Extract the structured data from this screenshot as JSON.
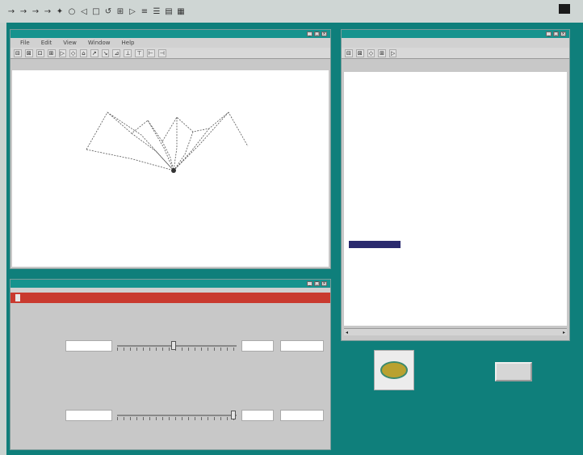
{
  "top_toolbar": {
    "icons": [
      "arrow-icon",
      "arrow-icon",
      "arrow-icon",
      "arrow-icon",
      "cursor-icon",
      "circle-icon",
      "pointer-icon",
      "square-icon",
      "undo-icon",
      "grid-icon",
      "shape-icon",
      "slider-icon",
      "list-icon",
      "save-icon",
      "print-icon"
    ],
    "glyphs": [
      "→",
      "→",
      "→",
      "→",
      "✦",
      "○",
      "◁",
      "□",
      "↺",
      "⊞",
      "▷",
      "≡",
      "☰",
      "▤",
      "▦"
    ]
  },
  "drawing_window": {
    "title": "",
    "menu": [
      "File",
      "Edit",
      "View",
      "Window",
      "Help"
    ],
    "toolbar_buttons": [
      "⊟",
      "⊠",
      "⊡",
      "⊞",
      "▷",
      "◇",
      "⌂",
      "↗",
      "↘",
      "⊿",
      "⊥",
      "⊤",
      "⊢",
      "⊣"
    ]
  },
  "list_window": {
    "title": "",
    "toolbar_buttons": [
      "⊟",
      "⊠",
      "◇",
      "⊞",
      "▷"
    ],
    "items": [
      "",
      "",
      "",
      "",
      "",
      "",
      "",
      "",
      "",
      "",
      "",
      "",
      "",
      "",
      "",
      "",
      "",
      "",
      "",
      "",
      "",
      "",
      ""
    ],
    "selected_index": 22
  },
  "controls_window": {
    "title": "",
    "tab_label": "",
    "slider1": {
      "label": "",
      "value": 0.47
    },
    "slider2": {
      "label": "",
      "value": 0.99
    }
  },
  "desktop": {
    "button_label": ""
  },
  "colors": {
    "desktop": "#0f7f7b",
    "titlebar": "#16938e",
    "red_bar": "#c93a2f",
    "selection": "#2a2a6e"
  }
}
